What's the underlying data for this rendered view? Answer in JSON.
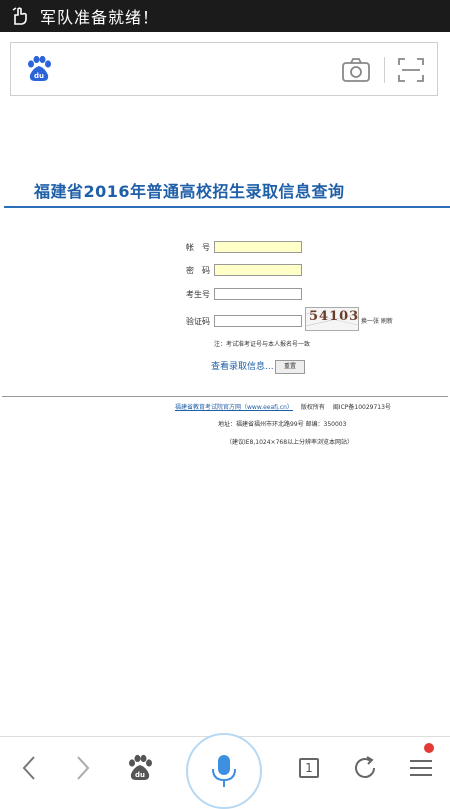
{
  "status_bar": {
    "notification_text": "军队准备就绪！"
  },
  "page": {
    "title": "福建省2016年普通高校招生录取信息查询",
    "form": {
      "account_label": "帐　号",
      "password_label": "密　码",
      "exam_number_label": "考生号",
      "captcha_label": "验证码",
      "captcha_text": "54103",
      "captcha_hint": "换一张 刷新",
      "note": "注：考试准考证号与本人报名号一致",
      "query_link": "查看录取信息...",
      "reset_label": "重置"
    },
    "footer": {
      "site_link": "福建省教育考试院官方网（www.eeafj.cn）",
      "copyright": "版权所有",
      "icp": "闽ICP备10029713号",
      "address": "地址：福建省福州市环北路99号 邮编：350003",
      "resolution_note": "（建议IE8,1024×768以上分辨率浏览本网站）"
    }
  },
  "nav": {
    "tab_count": "1"
  },
  "colors": {
    "accent": "#1f5fa8",
    "input_highlight": "#ffffc8",
    "badge": "#e53935"
  }
}
